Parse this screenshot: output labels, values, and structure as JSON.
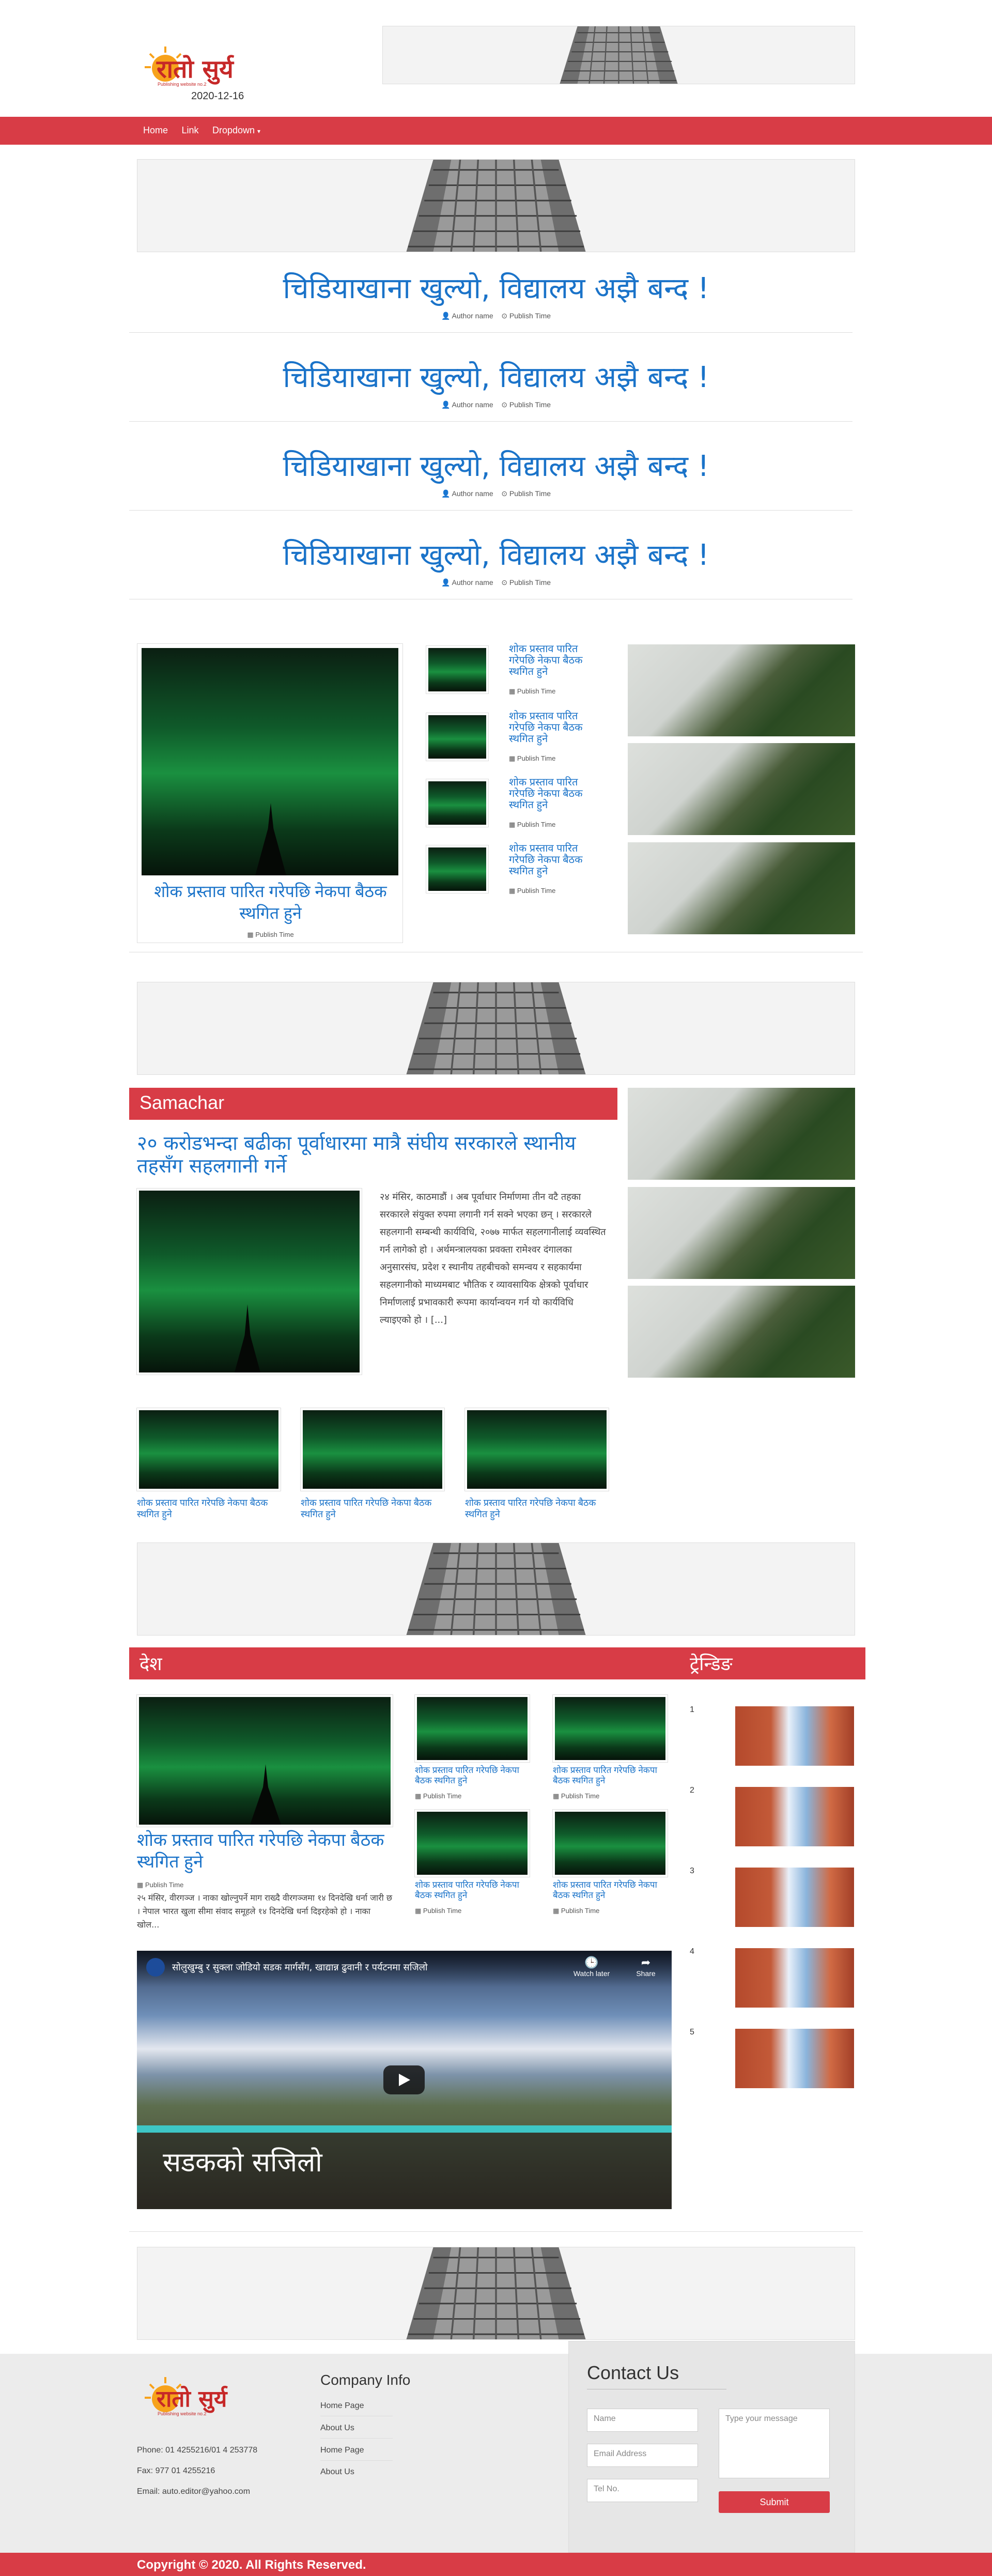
{
  "brand": {
    "logo_text": "रातो सुर्य",
    "logo_sub": "Publishing website no.2",
    "date": "2020-12-16"
  },
  "nav": {
    "home": "Home",
    "link": "Link",
    "dropdown": "Dropdown"
  },
  "top_headlines": [
    {
      "title": "चिडियाखाना खुल्यो, विद्यालय अझै बन्द !",
      "author": "Author name",
      "time": "Publish Time"
    },
    {
      "title": "चिडियाखाना खुल्यो, विद्यालय अझै बन्द !",
      "author": "Author name",
      "time": "Publish Time"
    },
    {
      "title": "चिडियाखाना खुल्यो, विद्यालय अझै बन्द !",
      "author": "Author name",
      "time": "Publish Time"
    },
    {
      "title": "चिडियाखाना खुल्यो, विद्यालय अझै बन्द !",
      "author": "Author name",
      "time": "Publish Time"
    }
  ],
  "featured": {
    "title": "शोक प्रस्ताव पारित गरेपछि नेकपा बैठक स्थगित हुने",
    "time": "Publish Time"
  },
  "side_news": [
    {
      "title": "शोक प्रस्ताव पारित गरेपछि नेकपा बैठक स्थगित हुने",
      "time": "Publish Time"
    },
    {
      "title": "शोक प्रस्ताव पारित गरेपछि नेकपा बैठक स्थगित हुने",
      "time": "Publish Time"
    },
    {
      "title": "शोक प्रस्ताव पारित गरेपछि नेकपा बैठक स्थगित हुने",
      "time": "Publish Time"
    },
    {
      "title": "शोक प्रस्ताव पारित गरेपछि नेकपा बैठक स्थगित हुने",
      "time": "Publish Time"
    }
  ],
  "samachar": {
    "section": "Samachar",
    "title": "२० करोडभन्दा बढीका पूर्वाधारमा मात्रै संघीय सरकारले स्थानीय तहसँग सहलगानी गर्ने",
    "body": "२४ मंसिर, काठमाडौं । अब पूर्वाधार निर्माणमा तीन वटै तहका सरकारले संयुक्त रुपमा लगानी गर्न सक्ने भएका छन् । सरकारले सहलगानी सम्बन्धी कार्यविधि, २०७७ मार्फत सहलगानीलाई व्यवस्थित गर्न लागेको हो । अर्थमन्त्रालयका प्रवक्ता रामेश्वर दंगालका अनुसारसंघ, प्रदेश र स्थानीय तहबीचको समन्वय र सहकार्यमा सहलगानीको माध्यमबाट भौतिक र व्यावसायिक क्षेत्रको पूर्वाधार निर्माणलाई प्रभावकारी रूपमा कार्यान्वयन गर्न यो कार्यविधि ल्याइएको हो । [...]",
    "cards": [
      {
        "title": "शोक प्रस्ताव पारित गरेपछि नेकपा बैठक स्थगित हुने"
      },
      {
        "title": "शोक प्रस्ताव पारित गरेपछि नेकपा बैठक स्थगित हुने"
      },
      {
        "title": "शोक प्रस्ताव पारित गरेपछि नेकपा बैठक स्थगित हुने"
      }
    ]
  },
  "desh": {
    "section": "देश",
    "title": "शोक प्रस्ताव पारित गरेपछि नेकपा बैठक स्थगित हुने",
    "time": "Publish Time",
    "excerpt": "२५ मंसिर, वीरगञ्ज । नाका खोल्नुपर्ने माग राख्दै वीरगञ्जमा १४ दिनदेखि धर्ना जारी छ । नेपाल भारत खुला सीमा संवाद समूहले १४ दिनदेखि धर्ना दिइरहेको हो । नाका खोल...",
    "grid": [
      {
        "title": "शोक प्रस्ताव पारित गरेपछि नेकपा बैठक स्थगित हुने",
        "time": "Publish Time"
      },
      {
        "title": "शोक प्रस्ताव पारित गरेपछि नेकपा बैठक स्थगित हुने",
        "time": "Publish Time"
      },
      {
        "title": "शोक प्रस्ताव पारित गरेपछि नेकपा बैठक स्थगित हुने",
        "time": "Publish Time"
      },
      {
        "title": "शोक प्रस्ताव पारित गरेपछि नेकपा बैठक स्थगित हुने",
        "time": "Publish Time"
      }
    ],
    "video": {
      "title": "सोलुखुम्बु र सुक्ला जोडियो सडक मार्गसँग, खाद्यान्न ढुवानी र पर्यटनमा सजिलो",
      "watch_later": "Watch later",
      "share": "Share",
      "caption": "सडकको सजिलो"
    }
  },
  "trending": {
    "section": "ट्रेन्डिङ",
    "items": [
      "1",
      "2",
      "3",
      "4",
      "5"
    ]
  },
  "footer": {
    "phone": "Phone: 01 4255216/01 4 253778",
    "fax": "Fax: 977 01 4255216",
    "email": "Email: auto.editor@yahoo.com",
    "company_title": "Company Info",
    "links": [
      "Home Page",
      "About Us",
      "Home Page",
      "About Us"
    ],
    "contact_title": "Contact Us",
    "name_ph": "Name",
    "email_ph": "Email Address",
    "tel_ph": "Tel No.",
    "message_ph": "Type your message",
    "submit": "Submit",
    "copyright": "Copyright © 2020. All Rights Reserved."
  },
  "colors": {
    "accent": "#d83c46",
    "link": "#1a73c9"
  }
}
